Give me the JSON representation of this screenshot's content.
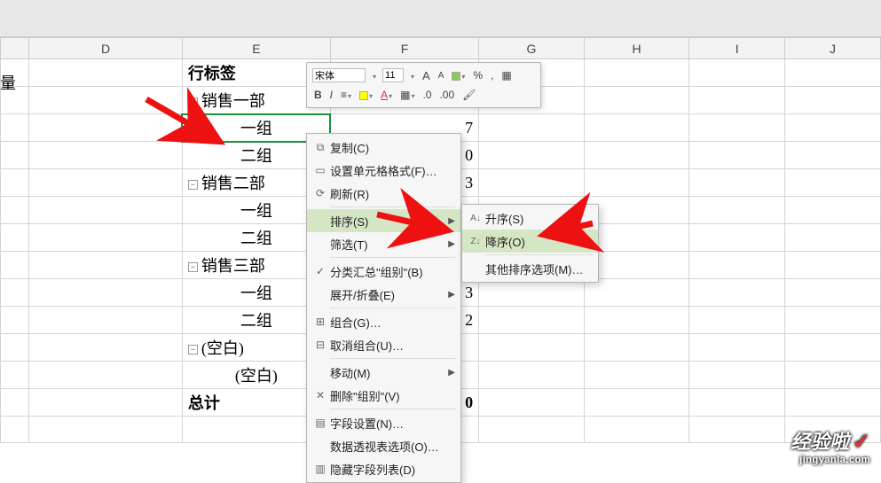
{
  "left_fragment": "量",
  "columns": {
    "d": "D",
    "e": "E",
    "f": "F",
    "g": "G",
    "h": "H",
    "i": "I",
    "j": "J"
  },
  "pivot": {
    "row_label_header": "行标签",
    "dept1": {
      "label": "销售一部",
      "g1": "一组",
      "g2": "二组"
    },
    "dept2": {
      "label": "销售二部",
      "g1": "一组",
      "g2": "二组"
    },
    "dept3": {
      "label": "销售三部",
      "g1": "一组",
      "g2": "二组"
    },
    "blank": {
      "label": "(空白)",
      "child": "(空白)"
    },
    "total": "总计"
  },
  "visible_values": {
    "dept1_g1": "7",
    "dept1_g2": "0",
    "dept2_hdr": "3",
    "dept3_g1": "3",
    "dept3_g2": "2",
    "total": "0"
  },
  "mini_toolbar": {
    "font_name": "宋体",
    "font_size": "11",
    "inc": "A",
    "dec": "A",
    "pct": "%",
    "comma": ",",
    "bold": "B",
    "italic": "I",
    "align": "≡",
    "dec_inc": ".0",
    "dec_dec": ".00"
  },
  "context_menu": {
    "copy": "复制(C)",
    "format_cells": "设置单元格格式(F)…",
    "refresh": "刷新(R)",
    "sort": "排序(S)",
    "filter": "筛选(T)",
    "subtotal": "分类汇总\"组别\"(B)",
    "expand": "展开/折叠(E)",
    "group": "组合(G)…",
    "ungroup": "取消组合(U)…",
    "move": "移动(M)",
    "remove": "删除\"组别\"(V)",
    "field_settings": "字段设置(N)…",
    "pivot_options": "数据透视表选项(O)…",
    "hide_field_list": "隐藏字段列表(D)"
  },
  "sort_submenu": {
    "asc": "升序(S)",
    "desc": "降序(O)",
    "more": "其他排序选项(M)…"
  },
  "icons": {
    "copy": "⧉",
    "format": "▭",
    "refresh": "⟳",
    "subtotal": "✓",
    "group": "⊞",
    "ungroup": "⊟",
    "remove": "✕",
    "field": "▤",
    "pivot": "",
    "hide": "▥",
    "asc": "A↓",
    "desc": "Z↓"
  },
  "watermark": {
    "brand": "经验啦",
    "check": "✓",
    "url": "jingyanla.com"
  }
}
